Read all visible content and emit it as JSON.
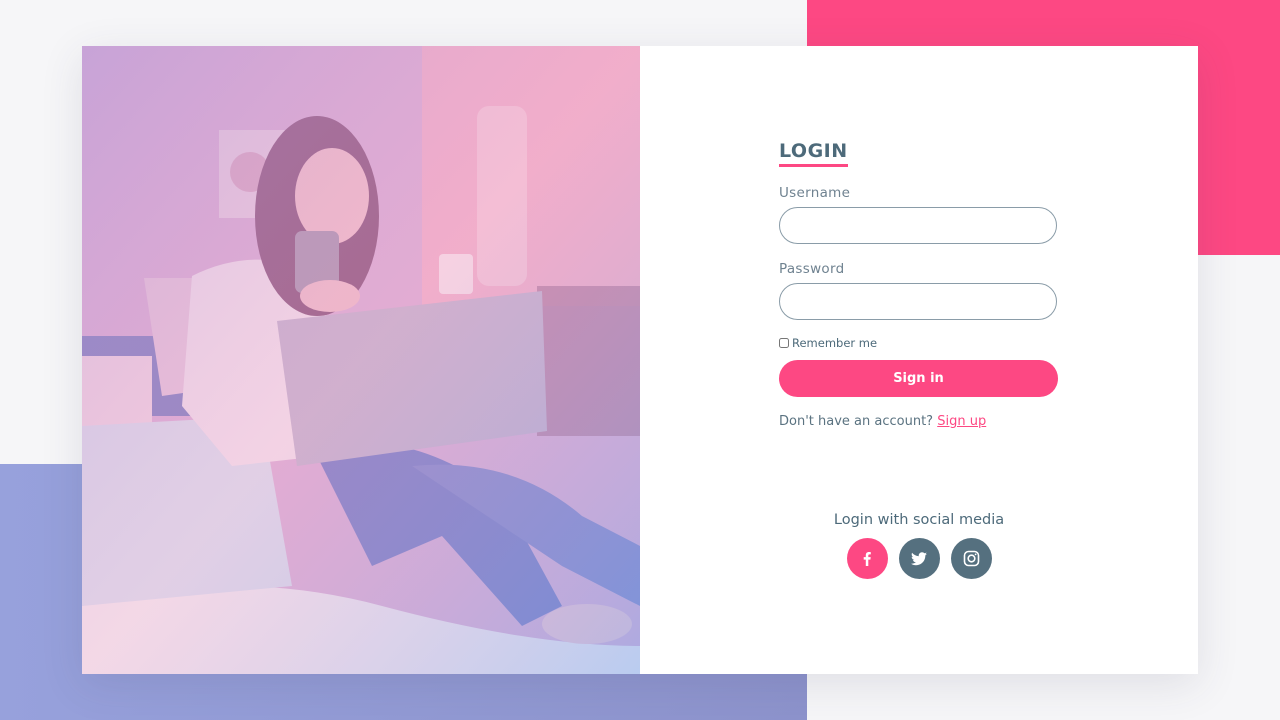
{
  "login": {
    "title": "LOGIN",
    "username_label": "Username",
    "username_value": "",
    "password_label": "Password",
    "password_value": "",
    "remember_label": "Remember me",
    "signin_label": "Sign in",
    "no_account_text": "Don't have an account?",
    "signup_link": "Sign up"
  },
  "social": {
    "title": "Login with social media",
    "icons": [
      "facebook-icon",
      "twitter-icon",
      "instagram-icon"
    ]
  },
  "colors": {
    "accent": "#fd4883",
    "text": "#4d6a7a",
    "icon_dark": "#55707f",
    "bg_blue": "#8f98d3"
  }
}
